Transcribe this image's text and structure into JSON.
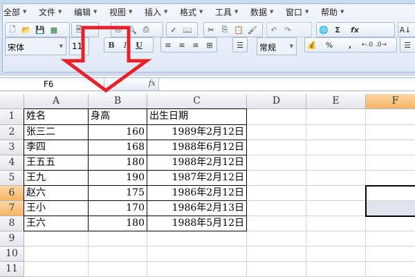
{
  "menu": [
    "全部",
    "文件",
    "编辑",
    "视图",
    "插入",
    "格式",
    "工具",
    "数据",
    "窗口",
    "帮助"
  ],
  "toolbar": {
    "font": "宋体",
    "size": "11",
    "bold": "B",
    "italic": "I",
    "underline": "U",
    "number_format": "常规",
    "percent": "%",
    "comma": ",",
    "sum": "Σ",
    "fx": "fx"
  },
  "formula_bar": {
    "name_box": "F6",
    "fx_label": "fx",
    "value": ""
  },
  "columns": [
    "A",
    "B",
    "C",
    "D",
    "E",
    "F"
  ],
  "rows": [
    "1",
    "2",
    "3",
    "4",
    "5",
    "6",
    "7",
    "8",
    "9",
    "10",
    "11"
  ],
  "table": {
    "headers": [
      "姓名",
      "身高",
      "出生日期"
    ],
    "data": [
      [
        "张三二",
        "160",
        "1989年2月12日"
      ],
      [
        "李四",
        "168",
        "1988年6月12日"
      ],
      [
        "王五五",
        "180",
        "1988年2月12日"
      ],
      [
        "王九",
        "190",
        "1987年2月12日"
      ],
      [
        "赵六",
        "175",
        "1986年2月12日"
      ],
      [
        "王小",
        "170",
        "1986年2月13日"
      ],
      [
        "王六",
        "180",
        "1988年5月12日"
      ]
    ]
  },
  "selection": "F6:F7",
  "colors": {
    "arrow": "#e8202a",
    "header_selected": "#f7b462"
  }
}
